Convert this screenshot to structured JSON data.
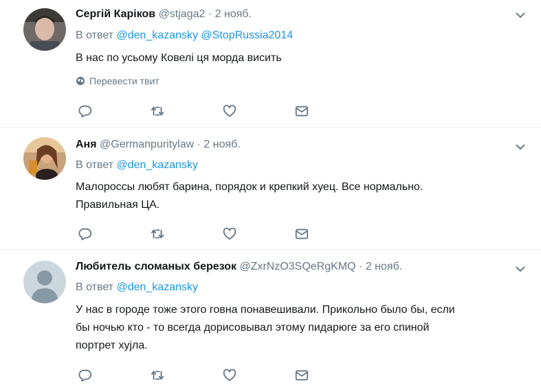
{
  "tweets": [
    {
      "name": "Сергій Каріков",
      "handle": "@stjaga2",
      "sep": "·",
      "time": "2 нояб.",
      "reply_prefix": "В ответ",
      "mentions": [
        "@den_kazansky",
        "@StopRussia2014"
      ],
      "lines": [
        "В нас по усьому Ковелі ця морда висить"
      ],
      "translate": "Перевести твит"
    },
    {
      "name": "Аня",
      "handle": "@Germanpuritylaw",
      "sep": "·",
      "time": "2 нояб.",
      "reply_prefix": "В ответ",
      "mentions": [
        "@den_kazansky"
      ],
      "lines": [
        "Малороссы любят барина, порядок и крепкий хуец. Все нормально.",
        "Правильная ЦА."
      ]
    },
    {
      "name": "Любитель сломаных березок",
      "handle": "@ZxrNzO3SQeRgKMQ",
      "sep": "·",
      "time": "2 нояб.",
      "reply_prefix": "В ответ",
      "mentions": [
        "@den_kazansky"
      ],
      "lines": [
        "У нас в городе тоже этого говна понавешивали. Прикольно было бы, если",
        "бы ночью кто - то всегда дорисовывал этому пидарюге за его спиной",
        "портрет хујла."
      ]
    }
  ],
  "colors": {
    "link": "#1b95e0",
    "secondary": "#657786",
    "text": "#14171a",
    "divider": "#e6ecf0"
  },
  "icons": [
    "chevron-down-icon",
    "reply-icon",
    "retweet-icon",
    "like-icon",
    "message-icon",
    "globe-icon"
  ]
}
